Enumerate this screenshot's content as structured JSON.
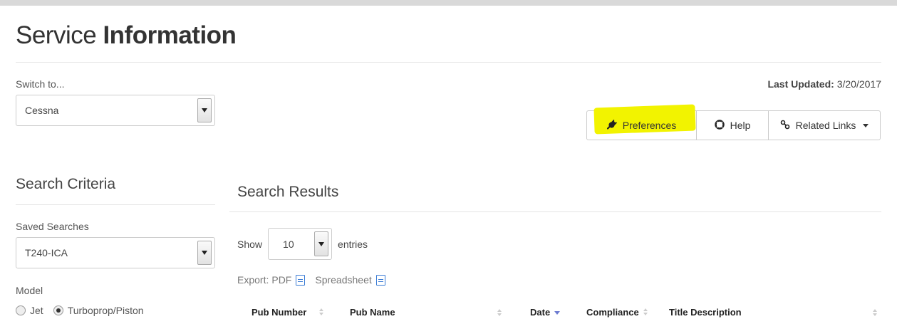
{
  "header": {
    "title_light": "Service",
    "title_bold": "Information"
  },
  "switcher": {
    "label": "Switch to...",
    "selected": "Cessna"
  },
  "last_updated": {
    "label": "Last Updated:",
    "value": "3/20/2017"
  },
  "toolbar": {
    "preferences_label": "Preferences",
    "help_label": "Help",
    "related_label": "Related Links"
  },
  "criteria": {
    "title": "Search Criteria",
    "saved_label": "Saved Searches",
    "saved_selected": "T240-ICA",
    "model_label": "Model",
    "model_options": [
      "Jet",
      "Turboprop/Piston"
    ],
    "model_selected": "Turboprop/Piston"
  },
  "results": {
    "title": "Search Results",
    "show_label": "Show",
    "entries_value": "10",
    "entries_label": "entries",
    "export_label": "Export:",
    "export_pdf": "PDF",
    "export_spreadsheet": "Spreadsheet",
    "columns": [
      "Pub Number",
      "Pub Name",
      "Date",
      "Compliance",
      "Title Description"
    ]
  },
  "colors": {
    "highlight": "#f2f300",
    "sort_active": "#6b7ad0",
    "link": "#3a7bd5"
  }
}
